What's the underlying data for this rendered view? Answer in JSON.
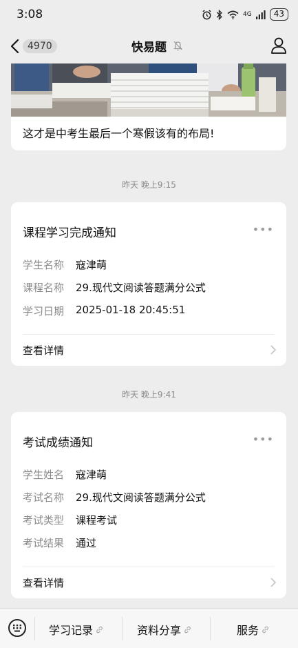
{
  "status_bar": {
    "time": "3:08",
    "network": "4G",
    "battery": "43"
  },
  "nav": {
    "badge": "4970",
    "title": "快易题"
  },
  "article": {
    "title": "这才是中考生最后一个寒假该有的布局!"
  },
  "messages": [
    {
      "time": "昨天 晚上9:15",
      "title": "课程学习完成通知",
      "fields": [
        {
          "label": "学生名称",
          "value": "寇津萌"
        },
        {
          "label": "课程名称",
          "value": "29.现代文阅读答题满分公式"
        },
        {
          "label": "学习日期",
          "value": "2025-01-18 20:45:51"
        }
      ],
      "detail_label": "查看详情"
    },
    {
      "time": "昨天 晚上9:41",
      "title": "考试成绩通知",
      "fields": [
        {
          "label": "学生姓名",
          "value": "寇津萌"
        },
        {
          "label": "考试名称",
          "value": "29.现代文阅读答题满分公式"
        },
        {
          "label": "考试类型",
          "value": "课程考试"
        },
        {
          "label": "考试结果",
          "value": "通过"
        }
      ],
      "detail_label": "查看详情"
    }
  ],
  "bottom_menu": [
    {
      "label": "学习记录"
    },
    {
      "label": "资料分享"
    },
    {
      "label": "服务"
    }
  ],
  "icons": {
    "back": "chevron-left-icon",
    "mute": "bell-off-icon",
    "profile": "user-icon",
    "more": "more-dots-icon",
    "chevron": "chevron-right-icon",
    "keyboard": "keyboard-icon",
    "link": "link-icon"
  }
}
